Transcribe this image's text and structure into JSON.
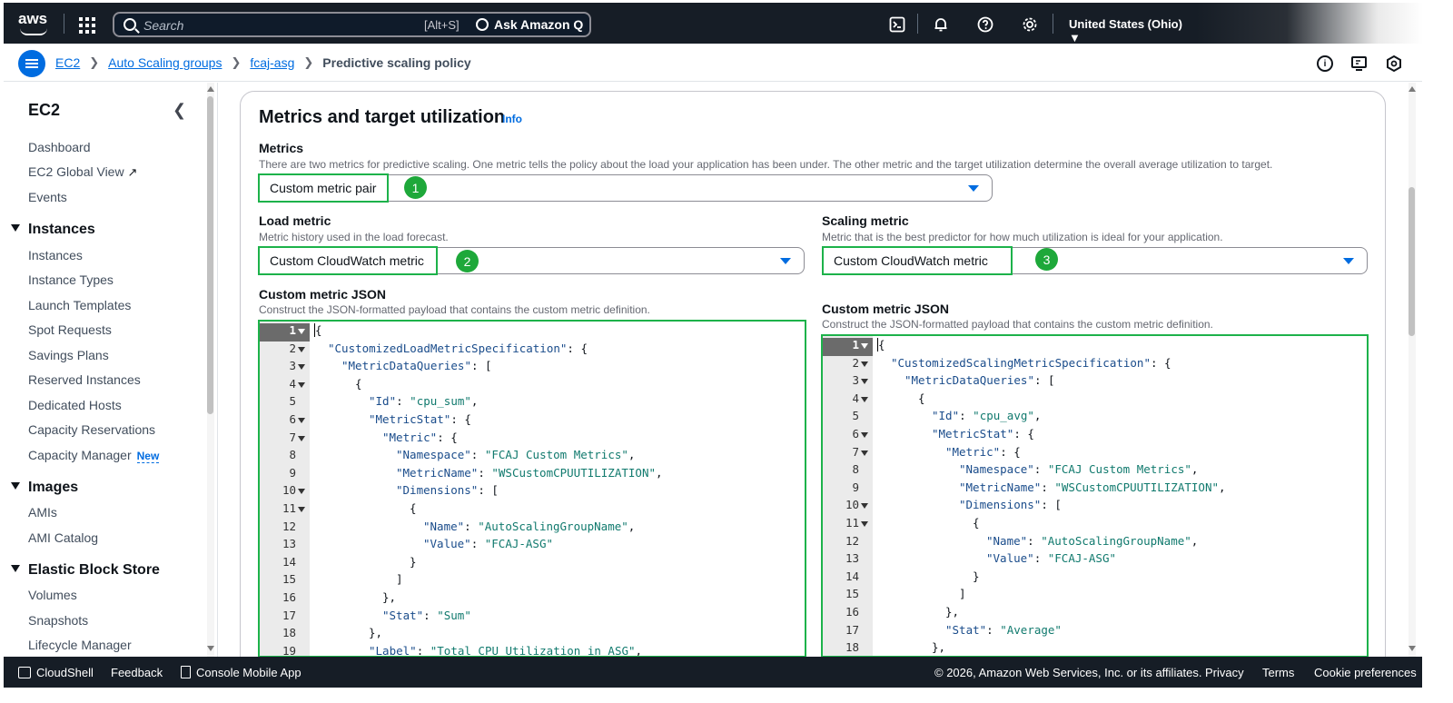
{
  "topnav": {
    "logo_text": "aws",
    "search_placeholder": "Search",
    "search_shortcut": "[Alt+S]",
    "ask_q_label": "Ask Amazon Q",
    "region": "United States (Ohio) ▼"
  },
  "breadcrumb": {
    "items": [
      "EC2",
      "Auto Scaling groups",
      "fcaj-asg"
    ],
    "current": "Predictive scaling policy"
  },
  "sidebar": {
    "title": "EC2",
    "top_items": [
      "Dashboard",
      "EC2 Global View",
      "Events"
    ],
    "sections": [
      {
        "title": "Instances",
        "items": [
          "Instances",
          "Instance Types",
          "Launch Templates",
          "Spot Requests",
          "Savings Plans",
          "Reserved Instances",
          "Dedicated Hosts",
          "Capacity Reservations",
          "Capacity Manager"
        ]
      },
      {
        "title": "Images",
        "items": [
          "AMIs",
          "AMI Catalog"
        ]
      },
      {
        "title": "Elastic Block Store",
        "items": [
          "Volumes",
          "Snapshots",
          "Lifecycle Manager"
        ]
      }
    ],
    "new_badge": "New"
  },
  "panel": {
    "title": "Metrics and target utilization",
    "info": "Info",
    "metrics_label": "Metrics",
    "metrics_desc": "There are two metrics for predictive scaling. One metric tells the policy about the load your application has been under. The other metric and the target utilization determine the overall average utilization to target.",
    "metrics_value": "Custom metric pair",
    "load_label": "Load metric",
    "load_desc": "Metric history used in the load forecast.",
    "load_value": "Custom CloudWatch metric",
    "scaling_label": "Scaling metric",
    "scaling_desc": "Metric that is the best predictor for how much utilization is ideal for your application.",
    "scaling_value": "Custom CloudWatch metric",
    "json_label": "Custom metric JSON",
    "json_desc": "Construct the JSON-formatted payload that contains the custom metric definition.",
    "badges": [
      "1",
      "2",
      "3"
    ]
  },
  "editor_left": {
    "lines": [
      {
        "n": "1",
        "fold": true,
        "indent": 0,
        "parts": [
          [
            "p",
            "{"
          ]
        ]
      },
      {
        "n": "2",
        "fold": true,
        "indent": 1,
        "parts": [
          [
            "k",
            "\"CustomizedLoadMetricSpecification\""
          ],
          [
            "p",
            ": {"
          ]
        ]
      },
      {
        "n": "3",
        "fold": true,
        "indent": 2,
        "parts": [
          [
            "k",
            "\"MetricDataQueries\""
          ],
          [
            "p",
            ": ["
          ]
        ]
      },
      {
        "n": "4",
        "fold": true,
        "indent": 3,
        "parts": [
          [
            "p",
            "{"
          ]
        ]
      },
      {
        "n": "5",
        "fold": false,
        "indent": 4,
        "parts": [
          [
            "k",
            "\"Id\""
          ],
          [
            "p",
            ": "
          ],
          [
            "s",
            "\"cpu_sum\""
          ],
          [
            "p",
            ","
          ]
        ]
      },
      {
        "n": "6",
        "fold": true,
        "indent": 4,
        "parts": [
          [
            "k",
            "\"MetricStat\""
          ],
          [
            "p",
            ": {"
          ]
        ]
      },
      {
        "n": "7",
        "fold": true,
        "indent": 5,
        "parts": [
          [
            "k",
            "\"Metric\""
          ],
          [
            "p",
            ": {"
          ]
        ]
      },
      {
        "n": "8",
        "fold": false,
        "indent": 6,
        "parts": [
          [
            "k",
            "\"Namespace\""
          ],
          [
            "p",
            ": "
          ],
          [
            "s",
            "\"FCAJ Custom Metrics\""
          ],
          [
            "p",
            ","
          ]
        ]
      },
      {
        "n": "9",
        "fold": false,
        "indent": 6,
        "parts": [
          [
            "k",
            "\"MetricName\""
          ],
          [
            "p",
            ": "
          ],
          [
            "s",
            "\"WSCustomCPUUTILIZATION\""
          ],
          [
            "p",
            ","
          ]
        ]
      },
      {
        "n": "10",
        "fold": true,
        "indent": 6,
        "parts": [
          [
            "k",
            "\"Dimensions\""
          ],
          [
            "p",
            ": ["
          ]
        ]
      },
      {
        "n": "11",
        "fold": true,
        "indent": 7,
        "parts": [
          [
            "p",
            "{"
          ]
        ]
      },
      {
        "n": "12",
        "fold": false,
        "indent": 8,
        "parts": [
          [
            "k",
            "\"Name\""
          ],
          [
            "p",
            ": "
          ],
          [
            "s",
            "\"AutoScalingGroupName\""
          ],
          [
            "p",
            ","
          ]
        ]
      },
      {
        "n": "13",
        "fold": false,
        "indent": 8,
        "parts": [
          [
            "k",
            "\"Value\""
          ],
          [
            "p",
            ": "
          ],
          [
            "s",
            "\"FCAJ-ASG\""
          ]
        ]
      },
      {
        "n": "14",
        "fold": false,
        "indent": 7,
        "parts": [
          [
            "p",
            "}"
          ]
        ]
      },
      {
        "n": "15",
        "fold": false,
        "indent": 6,
        "parts": [
          [
            "p",
            "]"
          ]
        ]
      },
      {
        "n": "16",
        "fold": false,
        "indent": 5,
        "parts": [
          [
            "p",
            "},"
          ]
        ]
      },
      {
        "n": "17",
        "fold": false,
        "indent": 5,
        "parts": [
          [
            "k",
            "\"Stat\""
          ],
          [
            "p",
            ": "
          ],
          [
            "s",
            "\"Sum\""
          ]
        ]
      },
      {
        "n": "18",
        "fold": false,
        "indent": 4,
        "parts": [
          [
            "p",
            "},"
          ]
        ]
      },
      {
        "n": "19",
        "fold": false,
        "indent": 4,
        "parts": [
          [
            "k",
            "\"Label\""
          ],
          [
            "p",
            ": "
          ],
          [
            "s",
            "\"Total CPU Utilization in ASG\""
          ],
          [
            "p",
            ","
          ]
        ]
      }
    ]
  },
  "editor_right": {
    "lines": [
      {
        "n": "1",
        "fold": true,
        "indent": 0,
        "parts": [
          [
            "p",
            "{"
          ]
        ]
      },
      {
        "n": "2",
        "fold": true,
        "indent": 1,
        "parts": [
          [
            "k",
            "\"CustomizedScalingMetricSpecification\""
          ],
          [
            "p",
            ": {"
          ]
        ]
      },
      {
        "n": "3",
        "fold": true,
        "indent": 2,
        "parts": [
          [
            "k",
            "\"MetricDataQueries\""
          ],
          [
            "p",
            ": ["
          ]
        ]
      },
      {
        "n": "4",
        "fold": true,
        "indent": 3,
        "parts": [
          [
            "p",
            "{"
          ]
        ]
      },
      {
        "n": "5",
        "fold": false,
        "indent": 4,
        "parts": [
          [
            "k",
            "\"Id\""
          ],
          [
            "p",
            ": "
          ],
          [
            "s",
            "\"cpu_avg\""
          ],
          [
            "p",
            ","
          ]
        ]
      },
      {
        "n": "6",
        "fold": true,
        "indent": 4,
        "parts": [
          [
            "k",
            "\"MetricStat\""
          ],
          [
            "p",
            ": {"
          ]
        ]
      },
      {
        "n": "7",
        "fold": true,
        "indent": 5,
        "parts": [
          [
            "k",
            "\"Metric\""
          ],
          [
            "p",
            ": {"
          ]
        ]
      },
      {
        "n": "8",
        "fold": false,
        "indent": 6,
        "parts": [
          [
            "k",
            "\"Namespace\""
          ],
          [
            "p",
            ": "
          ],
          [
            "s",
            "\"FCAJ Custom Metrics\""
          ],
          [
            "p",
            ","
          ]
        ]
      },
      {
        "n": "9",
        "fold": false,
        "indent": 6,
        "parts": [
          [
            "k",
            "\"MetricName\""
          ],
          [
            "p",
            ": "
          ],
          [
            "s",
            "\"WSCustomCPUUTILIZATION\""
          ],
          [
            "p",
            ","
          ]
        ]
      },
      {
        "n": "10",
        "fold": true,
        "indent": 6,
        "parts": [
          [
            "k",
            "\"Dimensions\""
          ],
          [
            "p",
            ": ["
          ]
        ]
      },
      {
        "n": "11",
        "fold": true,
        "indent": 7,
        "parts": [
          [
            "p",
            "{"
          ]
        ]
      },
      {
        "n": "12",
        "fold": false,
        "indent": 8,
        "parts": [
          [
            "k",
            "\"Name\""
          ],
          [
            "p",
            ": "
          ],
          [
            "s",
            "\"AutoScalingGroupName\""
          ],
          [
            "p",
            ","
          ]
        ]
      },
      {
        "n": "13",
        "fold": false,
        "indent": 8,
        "parts": [
          [
            "k",
            "\"Value\""
          ],
          [
            "p",
            ": "
          ],
          [
            "s",
            "\"FCAJ-ASG\""
          ]
        ]
      },
      {
        "n": "14",
        "fold": false,
        "indent": 7,
        "parts": [
          [
            "p",
            "}"
          ]
        ]
      },
      {
        "n": "15",
        "fold": false,
        "indent": 6,
        "parts": [
          [
            "p",
            "]"
          ]
        ]
      },
      {
        "n": "16",
        "fold": false,
        "indent": 5,
        "parts": [
          [
            "p",
            "},"
          ]
        ]
      },
      {
        "n": "17",
        "fold": false,
        "indent": 5,
        "parts": [
          [
            "k",
            "\"Stat\""
          ],
          [
            "p",
            ": "
          ],
          [
            "s",
            "\"Average\""
          ]
        ]
      },
      {
        "n": "18",
        "fold": false,
        "indent": 4,
        "parts": [
          [
            "p",
            "},"
          ]
        ]
      }
    ]
  },
  "footer": {
    "cloudshell": "CloudShell",
    "feedback": "Feedback",
    "mobile_app": "Console Mobile App",
    "copyright": "© 2026, Amazon Web Services, Inc. or its affiliates.",
    "privacy": "Privacy",
    "terms": "Terms",
    "cookies": "Cookie preferences"
  },
  "colors": {
    "nav_bg": "#161d26",
    "link": "#006ce0",
    "highlight_box": "#1db24a",
    "badge": "#1ea83a"
  }
}
